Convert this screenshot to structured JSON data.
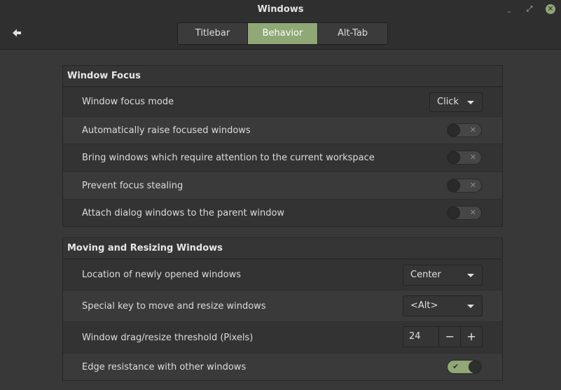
{
  "window": {
    "title": "Windows",
    "minimize_glyph": "ˍ",
    "maximize_glyph": "⤢",
    "close_glyph": "✕"
  },
  "tabs": [
    {
      "label": "Titlebar",
      "active": false
    },
    {
      "label": "Behavior",
      "active": true
    },
    {
      "label": "Alt-Tab",
      "active": false
    }
  ],
  "window_focus": {
    "heading": "Window Focus",
    "focus_mode": {
      "label": "Window focus mode",
      "value": "Click"
    },
    "auto_raise": {
      "label": "Automatically raise focused windows",
      "enabled": false
    },
    "bring_attention": {
      "label": "Bring windows which require attention to the current workspace",
      "enabled": false
    },
    "prevent_stealing": {
      "label": "Prevent focus stealing",
      "enabled": false
    },
    "attach_dialog": {
      "label": "Attach dialog windows to the parent window",
      "enabled": false
    }
  },
  "moving_resizing": {
    "heading": "Moving and Resizing Windows",
    "location": {
      "label": "Location of newly opened windows",
      "value": "Center"
    },
    "special_key": {
      "label": "Special key to move and resize windows",
      "value": "<Alt>"
    },
    "threshold": {
      "label": "Window drag/resize threshold (Pixels)",
      "value": "24",
      "minus": "−",
      "plus": "+"
    },
    "edge_resistance": {
      "label": "Edge resistance with other windows",
      "enabled": true
    }
  },
  "toggle_glyphs": {
    "off": "✕",
    "on": "✔"
  },
  "colors": {
    "accent": "#8fa876",
    "background": "#383838"
  }
}
